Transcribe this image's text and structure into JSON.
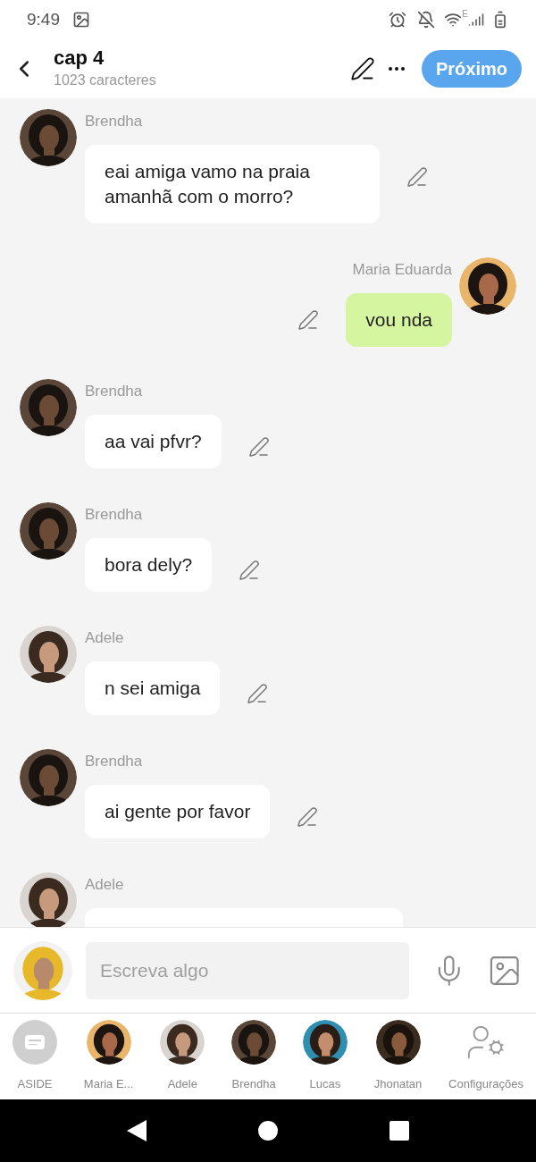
{
  "status_bar": {
    "time": "9:49",
    "network": "E"
  },
  "header": {
    "title": "cap 4",
    "subtitle": "1023 caracteres",
    "next_button": "Próximo"
  },
  "messages": [
    {
      "kind": "incoming",
      "author": "Brendha",
      "text": "eai amiga vamo na praia amanhã com o morro?"
    },
    {
      "kind": "outgoing",
      "author": "Maria Eduarda",
      "text": "vou nda"
    },
    {
      "kind": "incoming",
      "author": "Brendha",
      "text": "aa vai pfvr?"
    },
    {
      "kind": "incoming",
      "author": "Brendha",
      "text": "bora dely?"
    },
    {
      "kind": "incoming",
      "author": "Adele",
      "text": "n sei amiga"
    },
    {
      "kind": "incoming",
      "author": "Brendha",
      "text": "ai gente por favor"
    },
    {
      "kind": "incoming",
      "author": "Adele"
    }
  ],
  "composer": {
    "placeholder": "Escreva algo"
  },
  "characters": [
    {
      "kind": "aside",
      "label": "ASIDE"
    },
    {
      "kind": "character",
      "label": "Maria E..."
    },
    {
      "kind": "character",
      "label": "Adele"
    },
    {
      "kind": "character",
      "label": "Brendha"
    },
    {
      "kind": "character",
      "label": "Lucas"
    },
    {
      "kind": "character",
      "label": "Jhonatan"
    },
    {
      "kind": "settings",
      "label": "Configurações"
    }
  ]
}
